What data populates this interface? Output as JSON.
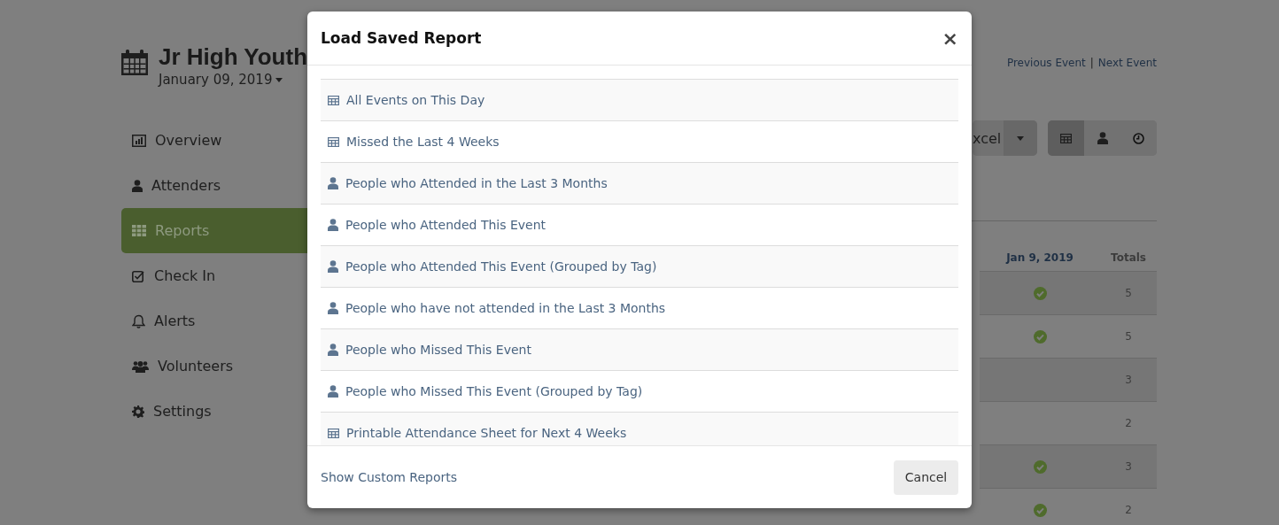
{
  "page": {
    "title": "Jr High Youth",
    "date": "January 09, 2019",
    "links": [
      "Previous Event",
      "|",
      "Next Event"
    ]
  },
  "sidebar": {
    "items": [
      {
        "label": "Overview",
        "selected": false
      },
      {
        "label": "Attenders",
        "selected": false
      },
      {
        "label": "Reports",
        "selected": true
      },
      {
        "label": "Check In",
        "selected": false
      },
      {
        "label": "Alerts",
        "selected": false
      },
      {
        "label": "Volunteers",
        "selected": false
      },
      {
        "label": "Settings",
        "selected": false
      }
    ]
  },
  "toolbar": {
    "export_button": "xcel",
    "views": [
      {
        "selected": true
      },
      {
        "selected": false
      },
      {
        "selected": false
      }
    ]
  },
  "table": {
    "columns": [
      "Jan 9, 2019",
      "Totals"
    ],
    "rows": [
      {
        "attended": true,
        "total": "5"
      },
      {
        "attended": true,
        "total": "5"
      },
      {
        "attended": false,
        "total": "3"
      },
      {
        "attended": false,
        "total": "2"
      },
      {
        "attended": true,
        "total": "3"
      },
      {
        "attended": true,
        "total": "2"
      }
    ]
  },
  "modal": {
    "title": "Load Saved Report",
    "close": "×",
    "reports": [
      {
        "label": "All Events on This Day",
        "kind": "table"
      },
      {
        "label": "Missed the Last 4 Weeks",
        "kind": "table"
      },
      {
        "label": "People who Attended in the Last 3 Months",
        "kind": "person"
      },
      {
        "label": "People who Attended This Event",
        "kind": "person"
      },
      {
        "label": "People who Attended This Event (Grouped by Tag)",
        "kind": "person"
      },
      {
        "label": "People who have not attended in the Last 3 Months",
        "kind": "person"
      },
      {
        "label": "People who Missed This Event",
        "kind": "person"
      },
      {
        "label": "People who Missed This Event (Grouped by Tag)",
        "kind": "person"
      },
      {
        "label": "Printable Attendance Sheet for Next 4 Weeks",
        "kind": "table"
      }
    ],
    "footer_link": "Show Custom Reports",
    "cancel": "Cancel"
  }
}
